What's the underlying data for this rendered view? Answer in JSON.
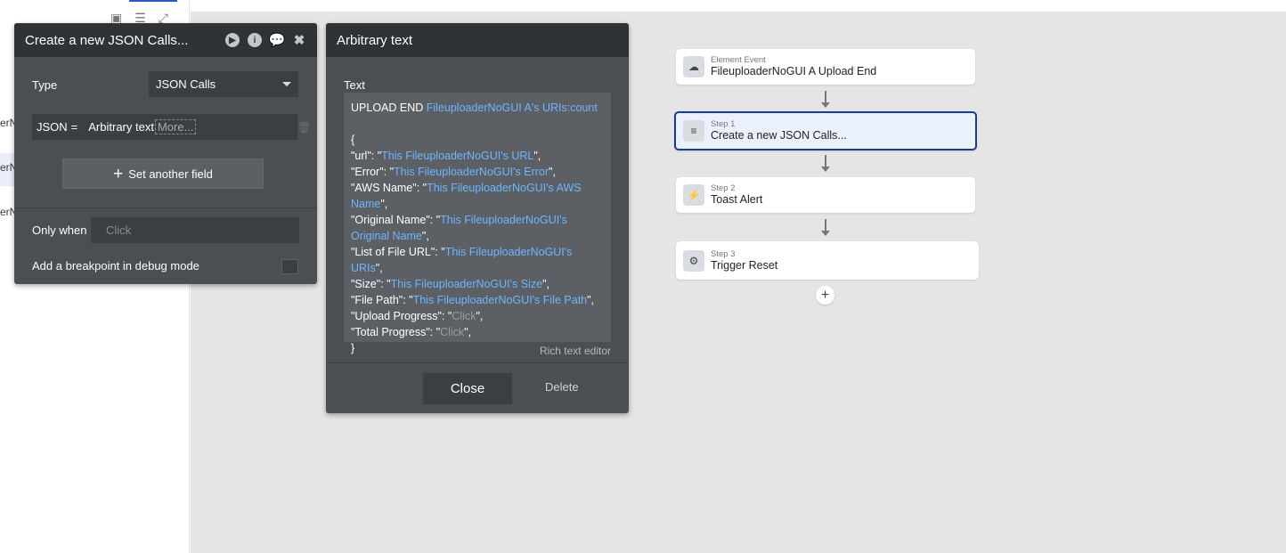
{
  "sidebar": {
    "fragments": [
      "erN",
      "erN",
      "erN"
    ],
    "tool_icons": [
      "add-folder-icon",
      "sliders-icon",
      "expand-icon"
    ]
  },
  "json_panel": {
    "title": "Create a new JSON Calls...",
    "header_icons": [
      "play-icon",
      "info-icon",
      "comment-icon",
      "close-icon"
    ],
    "type_label": "Type",
    "type_value": "JSON Calls",
    "field_name": "JSON",
    "field_eq": "=",
    "field_value": "Arbitrary text",
    "field_more": "More...",
    "set_another_label": "Set another field",
    "only_when_label": "Only when",
    "only_when_placeholder": "Click",
    "breakpoint_label": "Add a breakpoint in debug mode"
  },
  "text_panel": {
    "title": "Arbitrary text",
    "text_label": "Text",
    "line1_static": "UPLOAD END ",
    "line1_dyn": "FileuploaderNoGUI A's URIs:count",
    "open_brace": "{",
    "lines": [
      {
        "key": "\"url\": \"",
        "dyn": "This FileuploaderNoGUI's URL",
        "end": "\","
      },
      {
        "key": "\"Error\": \"",
        "dyn": "This FileuploaderNoGUI's Error",
        "end": "\","
      },
      {
        "key": "\"AWS Name\": \"",
        "dyn": "This FileuploaderNoGUI's AWS Name",
        "end": "\","
      },
      {
        "key": "\"Original Name\": \"",
        "dyn": "This FileuploaderNoGUI's Original Name",
        "end": "\","
      },
      {
        "key": "\"List of File URL\": \"",
        "dyn": "This FileuploaderNoGUI's URIs",
        "end": "\","
      },
      {
        "key": "\"Size\": \"",
        "dyn": "This FileuploaderNoGUI's Size",
        "end": "\","
      },
      {
        "key": "\"File Path\": \"",
        "dyn": "This FileuploaderNoGUI's File Path",
        "end": "\","
      },
      {
        "key": "\"Upload Progress\": \"",
        "ph": "Click",
        "end": "\","
      },
      {
        "key": "\"Total Progress\": \"",
        "ph": "Click",
        "end": "\","
      }
    ],
    "close_brace": "}",
    "rte_label": "Rich text editor",
    "close_label": "Close",
    "delete_label": "Delete"
  },
  "workflow": {
    "event": {
      "sub": "Element Event",
      "main": "FileuploaderNoGUI A Upload End",
      "icon": "cloud-upload-icon"
    },
    "steps": [
      {
        "sub": "Step 1",
        "main": "Create a new JSON Calls...",
        "icon": "database-icon"
      },
      {
        "sub": "Step 2",
        "main": "Toast Alert",
        "icon": "plug-icon"
      },
      {
        "sub": "Step 3",
        "main": "Trigger Reset",
        "icon": "gear-icon"
      }
    ],
    "add_label": "+"
  }
}
